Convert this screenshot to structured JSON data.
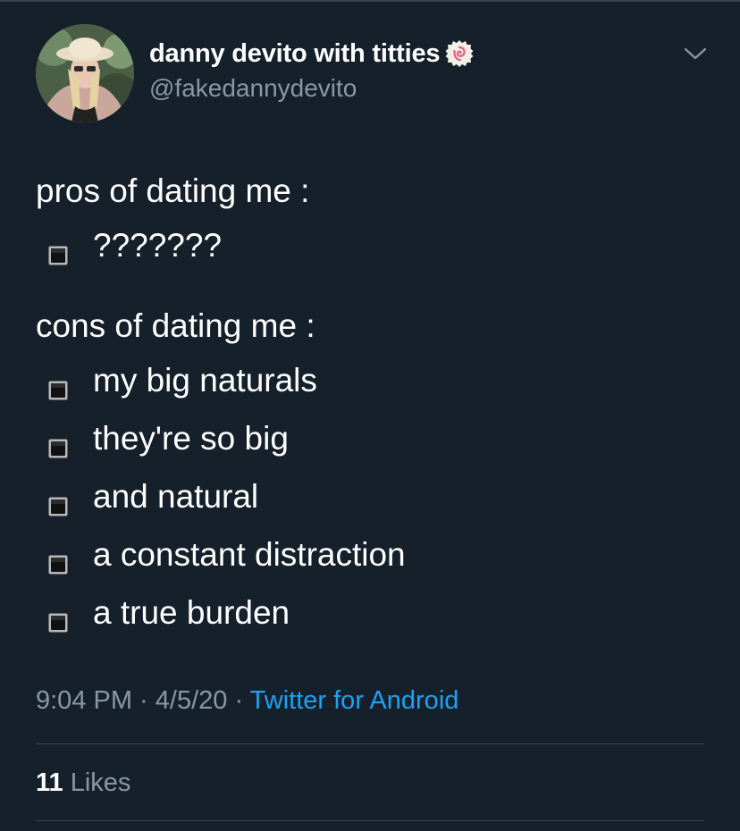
{
  "header": {
    "display_name": "danny devito with titties",
    "name_emoji": "narutomaki-emoji",
    "handle": "@fakedannydevito",
    "menu_icon": "chevron-down-icon"
  },
  "tweet": {
    "pros_heading": "pros of dating me :",
    "pros_items": [
      "???????"
    ],
    "cons_heading": "cons of dating me :",
    "cons_items": [
      "my big naturals",
      "they're so big",
      "and natural",
      "a constant distraction",
      "a true burden"
    ],
    "bullet_icon": "black-square-button-icon"
  },
  "meta": {
    "time": "9:04 PM",
    "separator": " · ",
    "date": "4/5/20",
    "source": "Twitter for Android"
  },
  "stats": {
    "likes_count": "11",
    "likes_label": " Likes"
  },
  "colors": {
    "background": "#15202b",
    "text": "#ffffff",
    "muted": "#8899a6",
    "link": "#1da1f2",
    "divider": "#38444d"
  }
}
